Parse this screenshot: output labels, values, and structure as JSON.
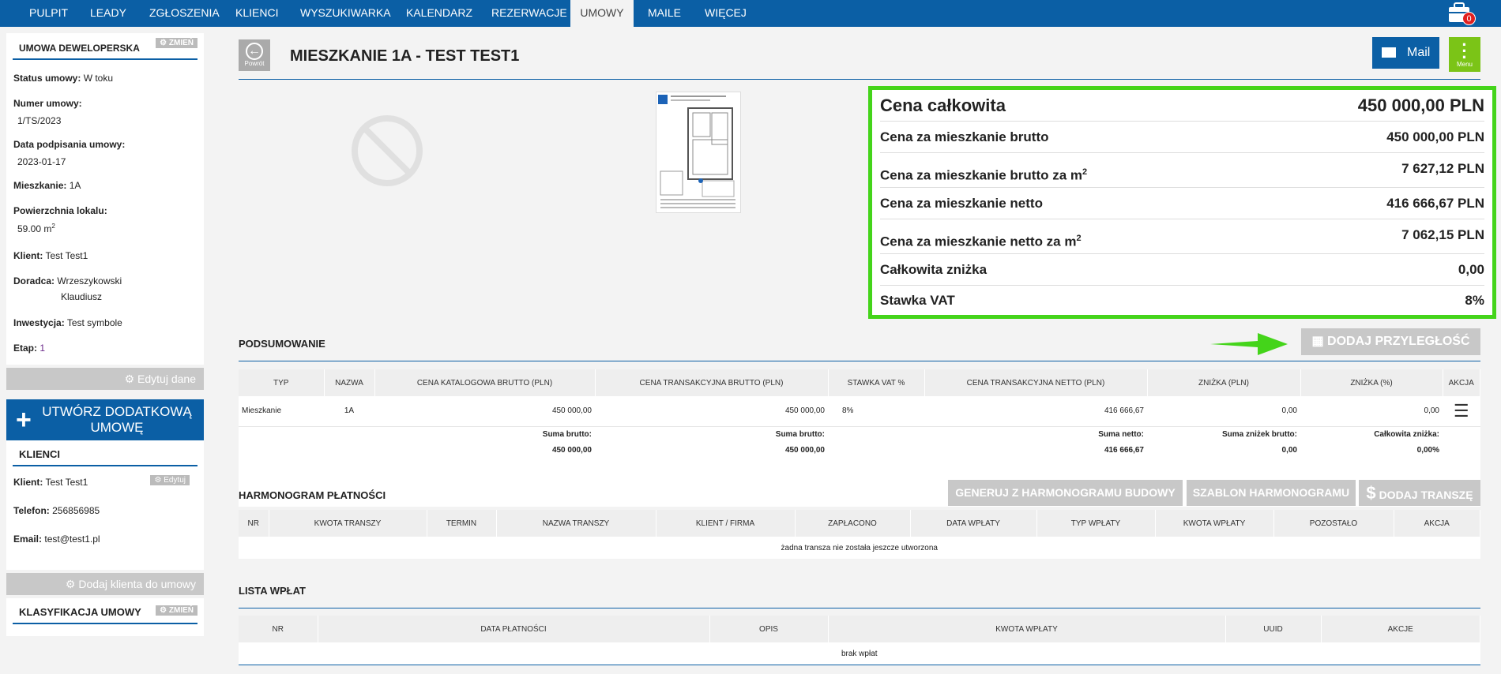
{
  "nav": [
    "PULPIT",
    "LEADY",
    "ZGŁOSZENIA",
    "KLIENCI",
    "WYSZUKIWARKA",
    "KALENDARZ",
    "REZERWACJE",
    "UMOWY",
    "MAILE",
    "WIĘCEJ"
  ],
  "nav_active": "UMOWY",
  "badge_count": "0",
  "sidebar": {
    "contract_title": "UMOWA DEWELOPERSKA",
    "zmien": "ZMIEŃ",
    "status_label": "Status umowy:",
    "status_value": "W toku",
    "number_label": "Numer umowy:",
    "number_value": "1/TS/2023",
    "date_label": "Data podpisania umowy:",
    "date_value": "2023-01-17",
    "apartment_label": "Mieszkanie:",
    "apartment_value": "1A",
    "area_label": "Powierzchnia lokalu:",
    "area_value": "59.00 m",
    "area_sup": "2",
    "client_label": "Klient:",
    "client_value": "Test Test1",
    "advisor_label": "Doradca:",
    "advisor_value_1": "Wrzeszykowski",
    "advisor_value_2": "Klaudiusz",
    "investment_label": "Inwestycja:",
    "investment_value": "Test symbole",
    "stage_label": "Etap:",
    "stage_value": "1",
    "edit_button": "Edytuj dane",
    "create_button_1": "UTWÓRZ DODATKOWĄ",
    "create_button_2": "UMOWĘ",
    "clients_title": "KLIENCI",
    "client2_label": "Klient:",
    "client2_value": "Test Test1",
    "edit_small": "Edytuj",
    "phone_label": "Telefon:",
    "phone_value": "256856985",
    "email_label": "Email:",
    "email_value": "test@test1.pl",
    "add_client_button": "Dodaj klienta do umowy",
    "classification_title": "KLASYFIKACJA UMOWY",
    "zmien2": "ZMIEŃ"
  },
  "main": {
    "back_label": "Powrót",
    "title": "MIESZKANIE 1A - TEST TEST1",
    "mail_label": "Mail",
    "menu_label": "Menu"
  },
  "prices": [
    {
      "label": "Cena całkowita",
      "value": "450 000,00 PLN",
      "sup": ""
    },
    {
      "label": "Cena za mieszkanie brutto",
      "value": "450 000,00 PLN",
      "sup": ""
    },
    {
      "label": "Cena za mieszkanie brutto za m",
      "value": "7 627,12 PLN",
      "sup": "2"
    },
    {
      "label": "Cena za mieszkanie netto",
      "value": "416 666,67 PLN",
      "sup": ""
    },
    {
      "label": "Cena za mieszkanie netto za m",
      "value": "7 062,15 PLN",
      "sup": "2"
    },
    {
      "label": "Całkowita zniżka",
      "value": "0,00",
      "sup": ""
    },
    {
      "label": "Stawka VAT",
      "value": "8%",
      "sup": ""
    }
  ],
  "summary": {
    "title": "PODSUMOWANIE",
    "add_button": "DODAJ PRZYLEGŁOŚĆ",
    "headers": [
      "TYP",
      "NAZWA",
      "CENA KATALOGOWA BRUTTO (PLN)",
      "CENA TRANSAKCYJNA BRUTTO (PLN)",
      "STAWKA VAT %",
      "CENA TRANSAKCYJNA NETTO (PLN)",
      "ZNIŻKA (PLN)",
      "ZNIŻKA (%)",
      "AKCJA"
    ],
    "row": [
      "Mieszkanie",
      "1A",
      "450 000,00",
      "450 000,00",
      "8%",
      "416 666,67",
      "0,00",
      "0,00"
    ],
    "sum_brutto_label": "Suma brutto:",
    "sum_brutto_1": "450 000,00",
    "sum_brutto_label_2": "Suma brutto:",
    "sum_brutto_2": "450 000,00",
    "sum_netto_label": "Suma netto:",
    "sum_netto": "416 666,67",
    "sum_discount_label": "Suma zniżek brutto:",
    "sum_discount": "0,00",
    "total_discount_label": "Całkowita zniżka:",
    "total_discount": "0,00%"
  },
  "schedule": {
    "title": "HARMONOGRAM PŁATNOŚCI",
    "btn_generate": "GENERUJ Z HARMONOGRAMU BUDOWY",
    "btn_template": "SZABLON HARMONOGRAMU",
    "btn_add": "DODAJ TRANSZĘ",
    "headers": [
      "NR",
      "KWOTA TRANSZY",
      "TERMIN",
      "NAZWA TRANSZY",
      "KLIENT / FIRMA",
      "ZAPŁACONO",
      "DATA WPŁATY",
      "TYP WPŁATY",
      "KWOTA WPŁATY",
      "POZOSTAŁO",
      "AKCJA"
    ],
    "empty": "żadna transza nie została jeszcze utworzona"
  },
  "payments": {
    "title": "LISTA WPŁAT",
    "headers": [
      "NR",
      "DATA PŁATNOŚCI",
      "OPIS",
      "KWOTA WPŁATY",
      "UUID",
      "AKCJE"
    ],
    "empty": "brak wpłat"
  },
  "colors": {
    "brand": "#0b5fa5",
    "highlight": "#44d41a",
    "menu": "#7bc417"
  }
}
